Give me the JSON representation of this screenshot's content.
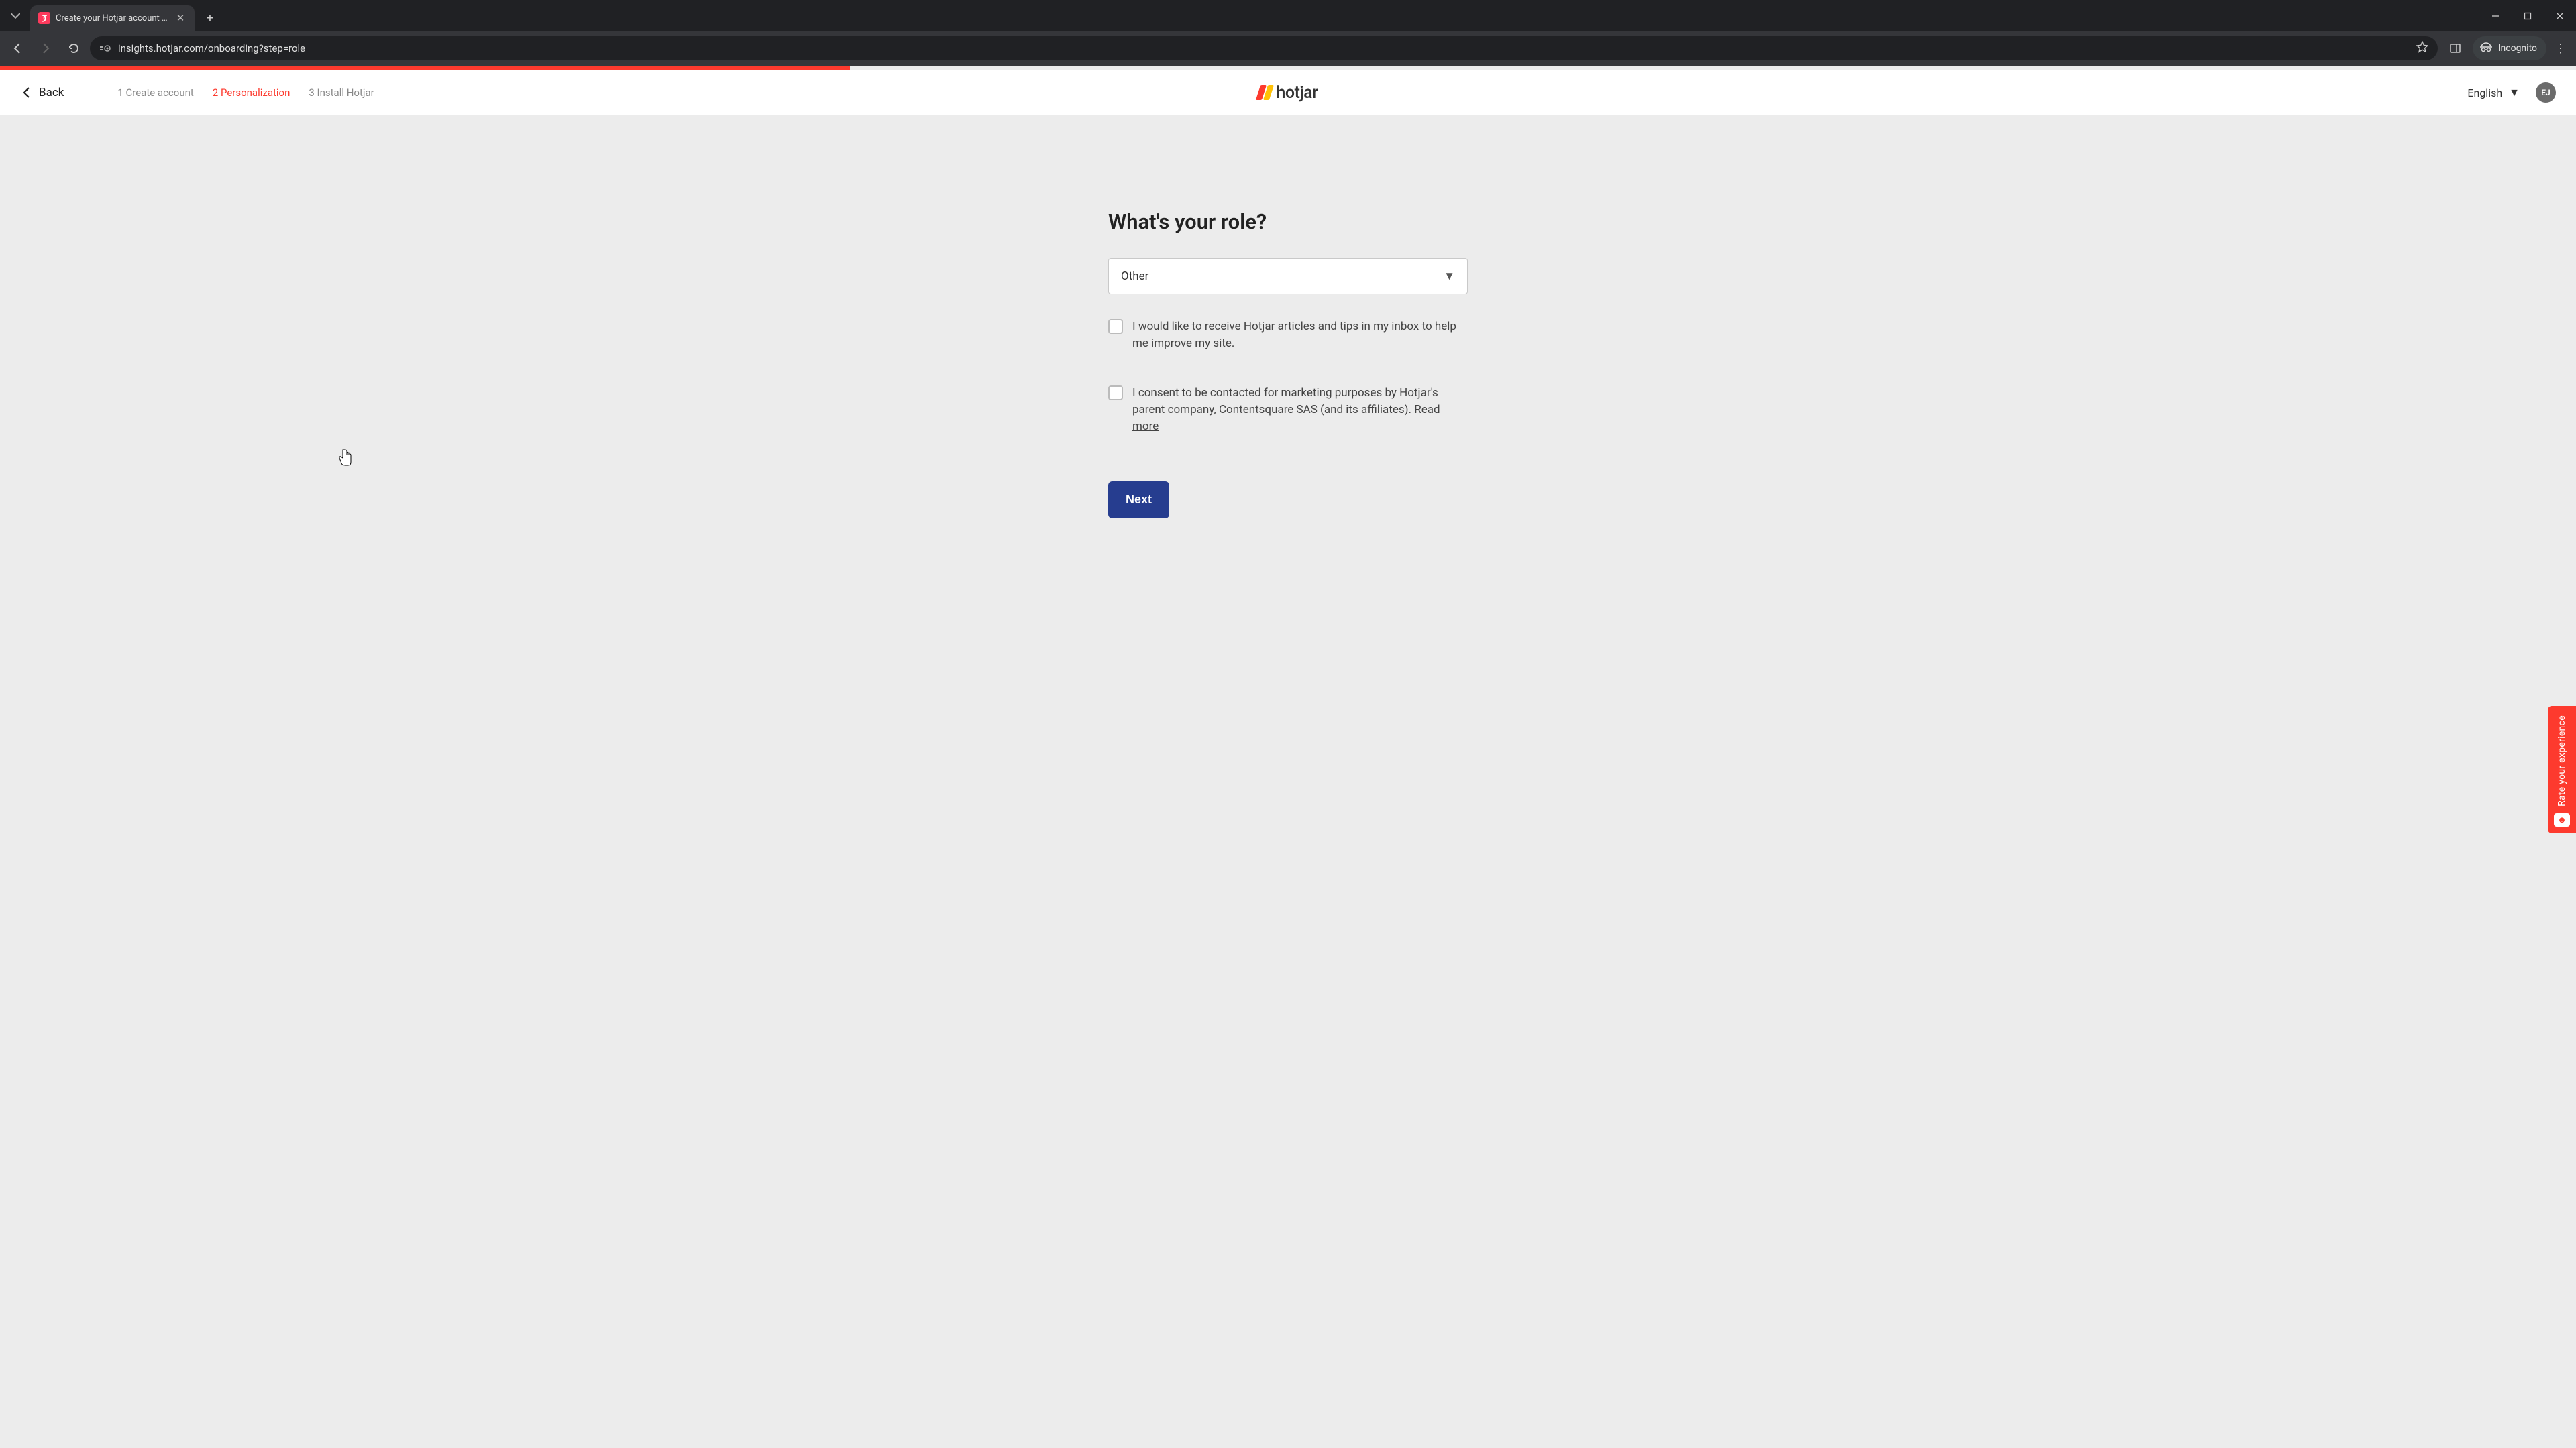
{
  "browser": {
    "tab_title": "Create your Hotjar account - Ho",
    "url": "insights.hotjar.com/onboarding?step=role",
    "incognito_label": "Incognito"
  },
  "header": {
    "back_label": "Back",
    "steps": {
      "s1": "1 Create account",
      "s2": "2 Personalization",
      "s3": "3 Install Hotjar"
    },
    "logo_text": "hotjar",
    "language": "English",
    "avatar_initials": "EJ"
  },
  "form": {
    "heading": "What's your role?",
    "role_value": "Other",
    "checkbox1_label": "I would like to receive Hotjar articles and tips in my inbox to help me improve my site.",
    "checkbox2_label_part1": "I consent to be contacted for marketing purposes by Hotjar's parent company, Contentsquare SAS (and its affiliates). ",
    "checkbox2_link": "Read more",
    "next_label": "Next"
  },
  "feedback": {
    "label": "Rate your experience"
  }
}
